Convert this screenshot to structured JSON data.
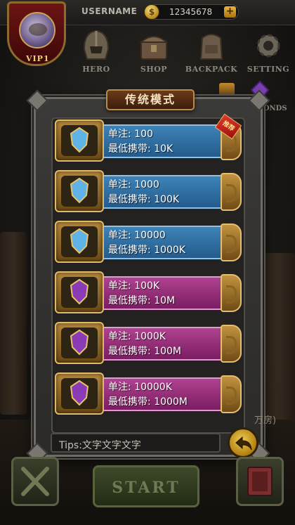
{
  "header": {
    "username_label": "USERNAME",
    "coins": "12345678",
    "plus": "+",
    "vip_label": "VIP1"
  },
  "nav": [
    {
      "label": "HERO",
      "icon": "helmet-icon"
    },
    {
      "label": "SHOP",
      "icon": "chest-icon"
    },
    {
      "label": "BACKPACK",
      "icon": "backpack-icon"
    },
    {
      "label": "SETTING",
      "icon": "gear-icon"
    }
  ],
  "diamonds_label": "AMONDS",
  "dialog": {
    "title": "传统模式",
    "rows": [
      {
        "line1": "单注: 100",
        "line2": "最低携带: 10K",
        "theme": "blue",
        "ribbon": "推荐"
      },
      {
        "line1": "单注: 1000",
        "line2": "最低携带: 100K",
        "theme": "blue"
      },
      {
        "line1": "单注: 10000",
        "line2": "最低携带: 1000K",
        "theme": "blue"
      },
      {
        "line1": "单注: 100K",
        "line2": "最低携带: 10M",
        "theme": "purple"
      },
      {
        "line1": "单注: 1000K",
        "line2": "最低携带: 100M",
        "theme": "purple"
      },
      {
        "line1": "单注: 10000K",
        "line2": "最低携带: 1000M",
        "theme": "purple"
      }
    ],
    "tips": "Tips:文字文字文字"
  },
  "side_text": "万房)",
  "bottom": {
    "start_label": "START"
  },
  "colors": {
    "blue_bar": "#2f6fa3",
    "purple_bar": "#9a2d7a",
    "gold": "#c9a35a"
  }
}
